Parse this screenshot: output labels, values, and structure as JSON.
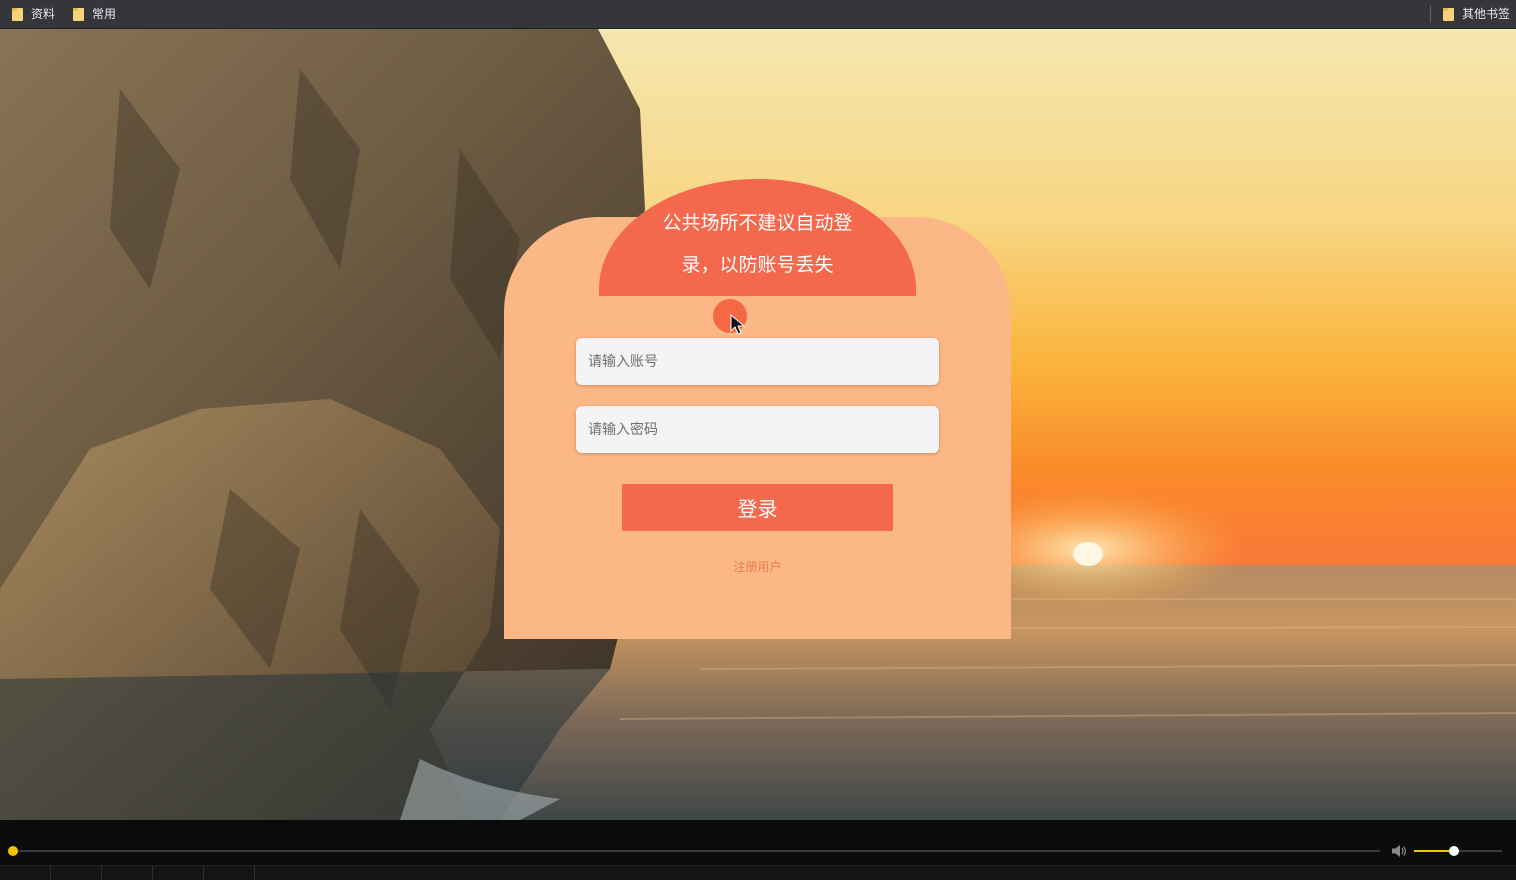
{
  "bookmarks": {
    "left": [
      {
        "label": "资料",
        "icon": "folder-icon"
      },
      {
        "label": "常用",
        "icon": "folder-icon"
      }
    ],
    "right": {
      "label": "其他书签",
      "icon": "folder-icon"
    }
  },
  "login": {
    "notice": "公共场所不建议自动登录，以防账号丢失",
    "account_placeholder": "请输入账号",
    "password_placeholder": "请输入密码",
    "login_label": "登录",
    "register_label": "注册用户"
  },
  "player": {
    "progress": 0.0,
    "volume": 0.45
  },
  "colors": {
    "card": "#fcb786",
    "accent": "#f4694d",
    "link": "#e8804f",
    "seek": "#f3c300"
  }
}
